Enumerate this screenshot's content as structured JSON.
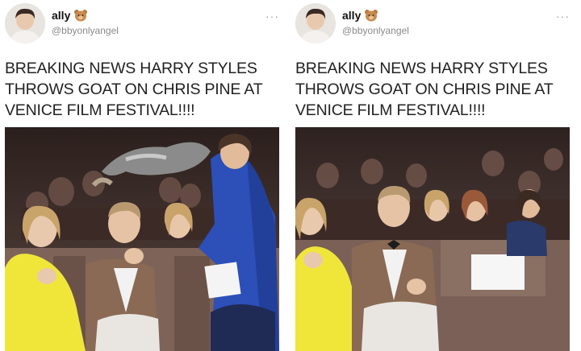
{
  "posts": [
    {
      "user": {
        "name": "ally",
        "emoji_icon": "teddy-bear-icon",
        "handle": "@bbyonlyangel"
      },
      "menu_icon": "more-options-icon",
      "text": "BREAKING NEWS HARRY STYLES\nTHROWS GOAT ON CHRIS PINE AT\nVENICE FILM FESTIVAL!!!!",
      "photo": {
        "scene": "goat-thrown",
        "description": ""
      }
    },
    {
      "user": {
        "name": "ally",
        "emoji_icon": "teddy-bear-icon",
        "handle": "@bbyonlyangel"
      },
      "menu_icon": "more-options-icon",
      "text": "BREAKING NEWS HARRY STYLES\nTHROWS GOAT ON CHRIS PINE AT\nVENICE FILM FESTIVAL!!!!",
      "photo": {
        "scene": "audience-seated",
        "description": ""
      }
    }
  ],
  "colors": {
    "text": "#222222",
    "handle": "#8a8a8a",
    "background": "#ffffff"
  }
}
